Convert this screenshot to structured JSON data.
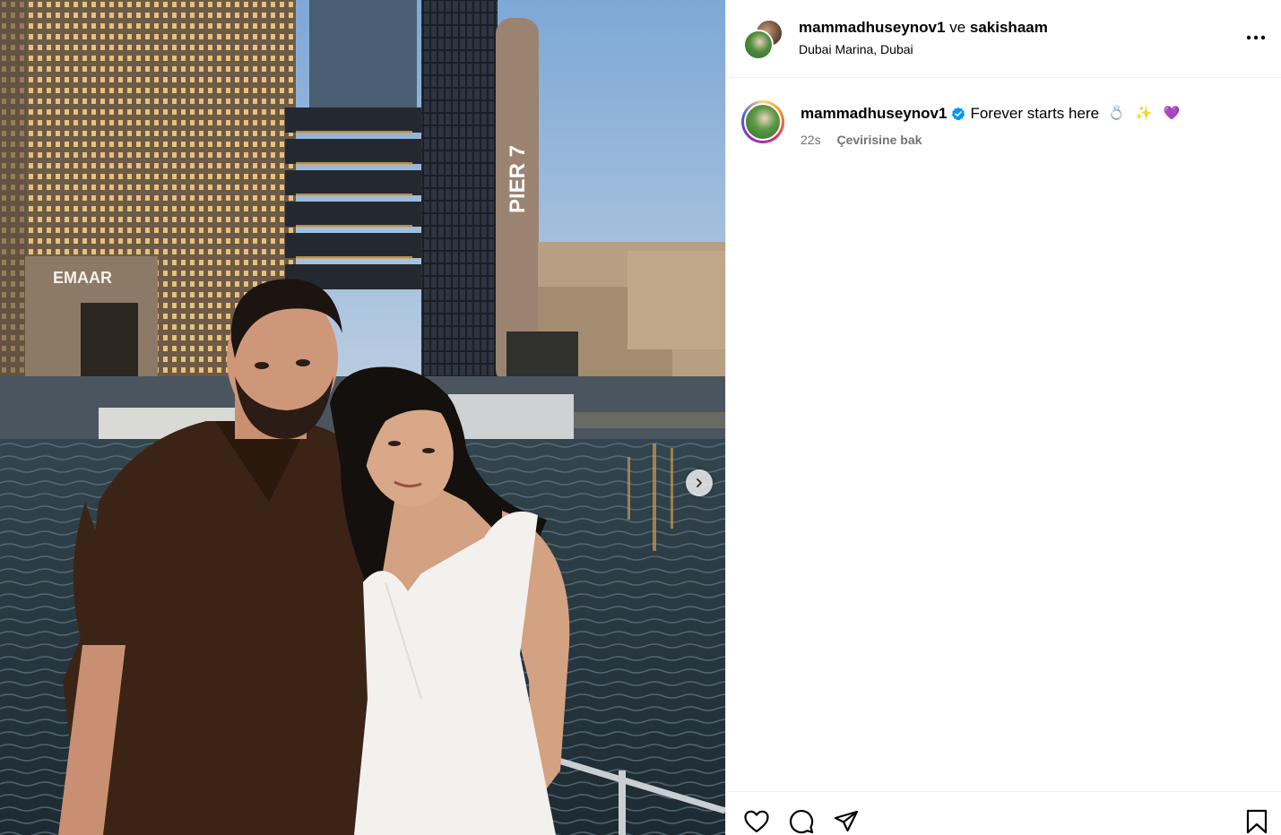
{
  "post": {
    "photo_alt": "",
    "next_icon": "chevron-right-icon"
  },
  "header": {
    "user_primary": "mammadhuseynov1",
    "conjunction": "ve",
    "user_secondary": "sakishaam",
    "location": "Dubai Marina, Dubai",
    "more_icon": "more-horizontal-icon"
  },
  "caption": {
    "username": "mammadhuseynov1",
    "verified_icon": "verified-badge-icon",
    "verified_color": "#0095f6",
    "text": "Forever starts here",
    "emojis": "💍 ✨ 💜",
    "time": "22s",
    "translate_label": "Çevirisine bak"
  },
  "actions": {
    "like_icon": "heart-icon",
    "comment_icon": "comment-icon",
    "share_icon": "share-icon",
    "save_icon": "bookmark-icon"
  },
  "colors": {
    "secondary_text": "#737373",
    "divider": "#efefef",
    "sky": "#8fb3d6"
  }
}
